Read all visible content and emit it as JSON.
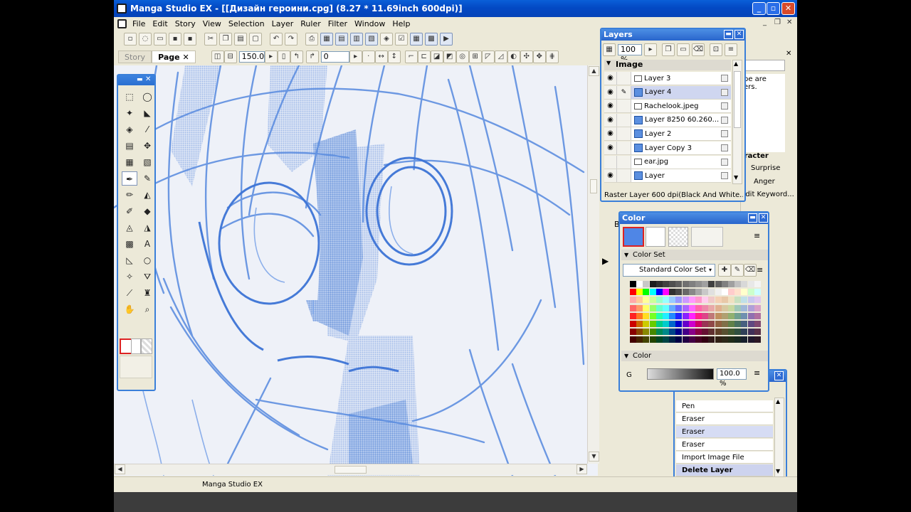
{
  "window": {
    "title": "Manga Studio EX - [[Дизайн героини.cpg] (8.27 * 11.69inch 600dpi)]",
    "min": "_",
    "max": "▫",
    "close": "✕"
  },
  "menu": [
    "File",
    "Edit",
    "Story",
    "View",
    "Selection",
    "Layer",
    "Ruler",
    "Filter",
    "Window",
    "Help"
  ],
  "toolbar2": {
    "story_tab": "Story",
    "page_tab": "Page",
    "close": "✕",
    "zoom": "150.0",
    "rotation": "0"
  },
  "layers_panel": {
    "title": "Layers",
    "opacity": "100 %",
    "group": "Image",
    "layers": [
      {
        "name": "Layer 3",
        "eye": true,
        "selected": false,
        "icon": "plain"
      },
      {
        "name": "Layer 4",
        "eye": true,
        "selected": true,
        "icon": "blue"
      },
      {
        "name": "Rachelook.jpeg",
        "eye": true,
        "selected": false,
        "icon": "plain"
      },
      {
        "name": "Layer 8250 60.260...",
        "eye": true,
        "selected": false,
        "icon": "blue"
      },
      {
        "name": "Layer 2",
        "eye": true,
        "selected": false,
        "icon": "blue"
      },
      {
        "name": "Layer Copy 3",
        "eye": true,
        "selected": false,
        "icon": "blue"
      },
      {
        "name": "ear.jpg",
        "eye": false,
        "selected": false,
        "icon": "plain"
      },
      {
        "name": "Layer",
        "eye": true,
        "selected": false,
        "icon": "blue"
      }
    ],
    "status": "Raster Layer 600 dpi(Black And White..."
  },
  "right_panel": {
    "text1": "pe are",
    "text2": "ers.",
    "section": "aracter",
    "items": [
      "Surprise",
      "Anger"
    ],
    "edit": "Edit Keyword..."
  },
  "color_panel": {
    "title": "Color",
    "color_set_header": "Color Set",
    "color_set_value": "Standard Color Set",
    "color_header": "Color",
    "channel": "G",
    "percent": "100.0 %",
    "main_color": "#4f86e6"
  },
  "history_panel": {
    "items": [
      "Pen",
      "Eraser",
      "Eraser",
      "Eraser",
      "Import Image File",
      "Delete Layer"
    ]
  },
  "side_label": "B",
  "status_text": "Manga Studio EX",
  "palette_colors": [
    [
      "#000000",
      "#ffffff",
      "#c8c8c8",
      "#1c1c1c",
      "#2e2e2e",
      "#404040",
      "#505050",
      "#606060",
      "#707070",
      "#808080",
      "#909090",
      "#a0a0a0",
      "#404040",
      "#606060",
      "#808080",
      "#a0a0a0",
      "#c0c0c0",
      "#d8d8d8",
      "#e8e8e8",
      "#f4f4f4"
    ],
    [
      "#ff0000",
      "#ffff00",
      "#00ff00",
      "#00ffff",
      "#0000ff",
      "#ff00ff",
      "#303030",
      "#484848",
      "#686868",
      "#888888",
      "#a8a8a8",
      "#c8c8c8",
      "#e0e0e0",
      "#f0f0f0",
      "#ffffff",
      "#ffcccc",
      "#ffe0cc",
      "#ffffcc",
      "#ccffcc",
      "#ccffff"
    ],
    [
      "#ffaaaa",
      "#ffcc99",
      "#ffff99",
      "#ccff99",
      "#99ffcc",
      "#99ffff",
      "#99ccff",
      "#9999ff",
      "#cc99ff",
      "#ff99ff",
      "#ff99cc",
      "#ffccee",
      "#f0c8c8",
      "#f4d0b4",
      "#e8c8a8",
      "#f0e0c0",
      "#c8e0c0",
      "#c0e0e8",
      "#c8c8f0",
      "#e0c8f0"
    ],
    [
      "#ff6666",
      "#ff9966",
      "#ffff66",
      "#99ff66",
      "#66ffcc",
      "#66ffff",
      "#66aaff",
      "#6666ff",
      "#aa66ff",
      "#ff66ff",
      "#ff66aa",
      "#ee88aa",
      "#e8a8a8",
      "#e0b090",
      "#d8c8a0",
      "#c8d8a0",
      "#a0c8b8",
      "#a0b8d8",
      "#b0a0d8",
      "#d8a0c8"
    ],
    [
      "#ff2222",
      "#ff7722",
      "#ffdd22",
      "#77ff22",
      "#22ffaa",
      "#22eeff",
      "#2288ff",
      "#2222ff",
      "#8822ff",
      "#ff22ff",
      "#ff2288",
      "#dd4488",
      "#c07878",
      "#c09060",
      "#b0a070",
      "#90b070",
      "#70a090",
      "#7090b0",
      "#9070b0",
      "#b070a0"
    ],
    [
      "#cc0000",
      "#cc6600",
      "#cccc00",
      "#66cc00",
      "#00cc88",
      "#00cccc",
      "#0066cc",
      "#0000cc",
      "#6600cc",
      "#cc00cc",
      "#cc0066",
      "#993355",
      "#904848",
      "#906040",
      "#807048",
      "#608048",
      "#487060",
      "#486080",
      "#604880",
      "#804870"
    ],
    [
      "#880000",
      "#884400",
      "#888800",
      "#448800",
      "#008855",
      "#008888",
      "#004488",
      "#000088",
      "#440088",
      "#880088",
      "#880044",
      "#661133",
      "#603030",
      "#604028",
      "#585030",
      "#405830",
      "#305040",
      "#304058",
      "#403058",
      "#583048"
    ],
    [
      "#440000",
      "#442200",
      "#444400",
      "#224400",
      "#004422",
      "#004444",
      "#002244",
      "#000044",
      "#220044",
      "#440044",
      "#440022",
      "#330011",
      "#301818",
      "#302014",
      "#2c2818",
      "#202c18",
      "#182820",
      "#18202c",
      "#20182c",
      "#2c1824"
    ]
  ]
}
